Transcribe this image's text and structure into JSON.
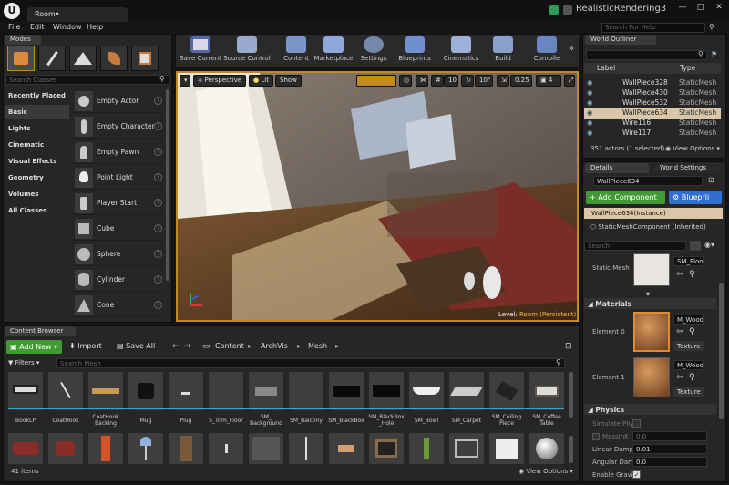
{
  "title_bar": {
    "tab": "Room•",
    "project": "RealisticRendering3"
  },
  "menu": [
    "File",
    "Edit",
    "Window",
    "Help"
  ],
  "search_help": {
    "placeholder": "Search For Help"
  },
  "modes": {
    "tab": "Modes",
    "search_placeholder": "Search Classes",
    "categories": [
      "Recently Placed",
      "Basic",
      "Lights",
      "Cinematic",
      "Visual Effects",
      "Geometry",
      "Volumes",
      "All Classes"
    ],
    "items": [
      "Empty Actor",
      "Empty Character",
      "Empty Pawn",
      "Point Light",
      "Player Start",
      "Cube",
      "Sphere",
      "Cylinder",
      "Cone"
    ]
  },
  "toolbar": [
    "Save Current",
    "Source Control",
    "Content",
    "Marketplace",
    "Settings",
    "Blueprints",
    "Cinematics",
    "Build",
    "Compile"
  ],
  "viewport": {
    "perspective": "Perspective",
    "lit": "Lit",
    "show": "Show",
    "grid_snap": "10",
    "rot_snap": "10°",
    "scale_snap": "0.25",
    "cam_speed": "4",
    "level_label": "Level:",
    "level_name": "Room (Persistent)"
  },
  "world_outliner": {
    "tab": "World Outliner",
    "col_label": "Label",
    "col_type": "Type",
    "rows": [
      {
        "label": "WallPiece328",
        "type": "StaticMesh"
      },
      {
        "label": "WallPiece430",
        "type": "StaticMesh"
      },
      {
        "label": "WallPiece532",
        "type": "StaticMesh"
      },
      {
        "label": "WallPiece634",
        "type": "StaticMesh"
      },
      {
        "label": "Wire116",
        "type": "StaticMesh"
      },
      {
        "label": "Wire117",
        "type": "StaticMesh"
      }
    ],
    "count": "351 actors (1 selected)",
    "view_options": "View Options"
  },
  "details": {
    "tab": "Details",
    "tab2": "World Settings",
    "name": "WallPiece634",
    "add_component": "+ Add Component",
    "blueprint": "Blueprii",
    "instance": "WallPiece634(Instance)",
    "component": "StaticMeshComponent (Inherited)",
    "search_placeholder": "Search",
    "static_mesh_label": "Static Mesh",
    "static_mesh_value": "SM_Floo",
    "materials_header": "Materials",
    "element0": "Element 0",
    "element1": "Element 1",
    "material_value": "M_Wood",
    "texture_btn": "Texture",
    "physics_header": "Physics",
    "simulate": "Simulate Phy",
    "mass": "MassInK",
    "mass_value": "0.0",
    "linear_label": "Linear Damp",
    "linear_value": "0.01",
    "angular_label": "Angular Dam",
    "angular_value": "0.0",
    "gravity_label": "Enable Gravit"
  },
  "content_browser": {
    "tab": "Content Browser",
    "add_new": "Add New",
    "import": "Import",
    "save_all": "Save All",
    "path": [
      "Content",
      "ArchVis",
      "Mesh"
    ],
    "filters": "Filters",
    "search_placeholder": "Search Mesh",
    "assets_row1": [
      "BookLP",
      "CoatHook",
      "CoatHook Backing",
      "Mug",
      "Plug",
      "S_Trim_Floor",
      "SM_ Background",
      "SM_Balcony",
      "SM_BlackBox",
      "SM_BlackBox _Hole",
      "SM_Bowl",
      "SM_Carpet",
      "SM_Ceiling Piece",
      "SM_Coffee Table"
    ],
    "item_count": "41 items",
    "view_options": "View Options"
  }
}
